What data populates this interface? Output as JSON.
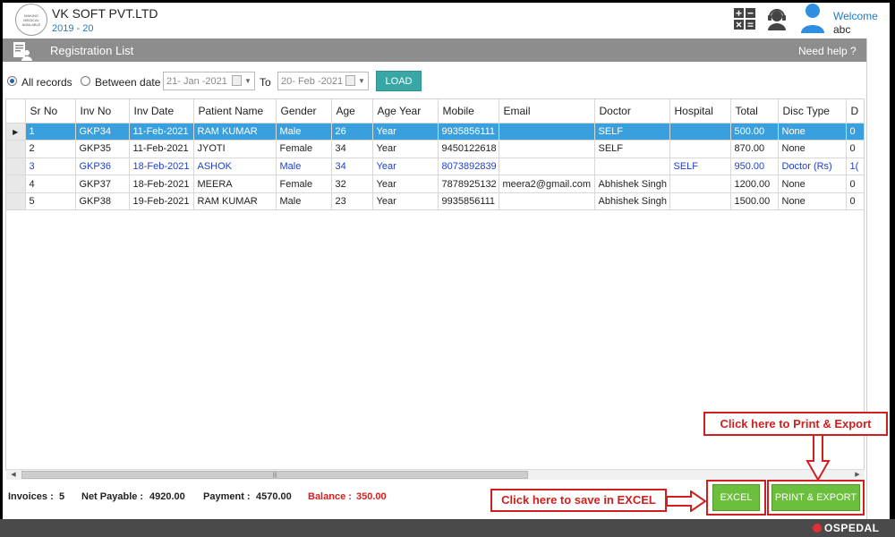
{
  "header": {
    "company": "VK SOFT PVT.LTD",
    "year": "2019 - 20",
    "logo_text": "MAKING MEDICAL AVAILABLE",
    "welcome": "Welcome",
    "username": "abc",
    "icons": [
      "calculator-icon",
      "support-headset-icon",
      "user-icon"
    ]
  },
  "titlebar": {
    "title": "Registration List",
    "help": "Need help ?"
  },
  "filters": {
    "all_records": "All records",
    "between_date": "Between date",
    "from_date": "21- Jan -2021",
    "to_label": "To",
    "to_date": "20- Feb -2021",
    "load": "LOAD",
    "selected": "all_records"
  },
  "table": {
    "columns": [
      "Sr No",
      "Inv No",
      "Inv Date",
      "Patient Name",
      "Gender",
      "Age",
      "Age Year",
      "Mobile",
      "Email",
      "Doctor",
      "Hospital",
      "Total",
      "Disc Type",
      "D"
    ],
    "rows": [
      [
        "1",
        "GKP34",
        "11-Feb-2021",
        "RAM KUMAR",
        "Male",
        "26",
        "Year",
        "9935856111",
        "",
        "SELF",
        "",
        "500.00",
        "None",
        "0"
      ],
      [
        "2",
        "GKP35",
        "11-Feb-2021",
        "JYOTI",
        "Female",
        "34",
        "Year",
        "9450122618",
        "",
        "SELF",
        "",
        "870.00",
        "None",
        "0"
      ],
      [
        "3",
        "GKP36",
        "18-Feb-2021",
        "ASHOK",
        "Male",
        "34",
        "Year",
        "8073892839",
        "",
        "",
        "SELF",
        "950.00",
        "Doctor (Rs)",
        "1("
      ],
      [
        "4",
        "GKP37",
        "18-Feb-2021",
        "MEERA",
        "Female",
        "32",
        "Year",
        "7878925132",
        "meera2@gmail.com",
        "Abhishek Singh",
        "",
        "1200.00",
        "None",
        "0"
      ],
      [
        "5",
        "GKP38",
        "19-Feb-2021",
        "RAM KUMAR",
        "Male",
        "23",
        "Year",
        "9935856111",
        "",
        "Abhishek Singh",
        "",
        "1500.00",
        "None",
        "0"
      ]
    ],
    "selected_row": 0,
    "highlight_row": 2
  },
  "totals": {
    "invoices_label": "Invoices :",
    "invoices": "5",
    "net_label": "Net Payable :",
    "net": "4920.00",
    "payment_label": "Payment :",
    "payment": "4570.00",
    "balance_label": "Balance :",
    "balance": "350.00"
  },
  "buttons": {
    "excel": "EXCEL",
    "print_export": "PRINT & EXPORT"
  },
  "callouts": {
    "print": "Click here to Print & Export",
    "excel": "Click here to save in EXCEL"
  },
  "brand": "OSPEDAL",
  "colors": {
    "accent_blue": "#3a9fdd",
    "load_teal": "#3aa7a7",
    "button_green": "#6cbf3c",
    "annotation_red": "#d01f1f"
  }
}
